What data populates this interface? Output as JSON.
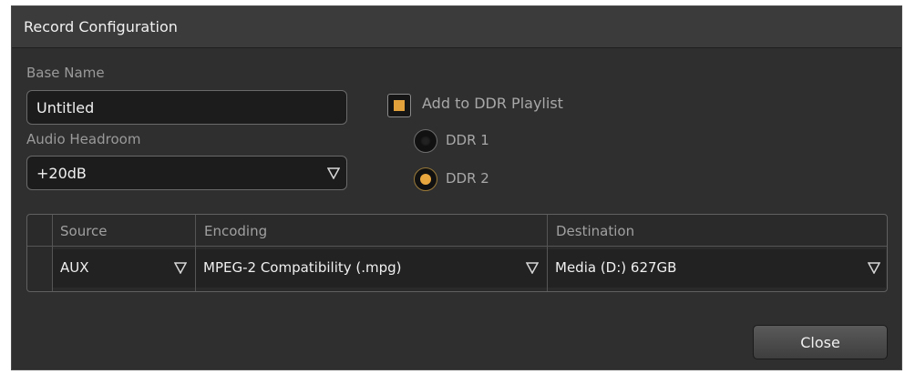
{
  "dialog": {
    "title": "Record Configuration"
  },
  "base_name": {
    "label": "Base Name",
    "value": "Untitled"
  },
  "audio_headroom": {
    "label": "Audio Headroom",
    "selected": "+20dB"
  },
  "ddr_playlist": {
    "checkbox_label": "Add to DDR Playlist",
    "checked": true,
    "options": [
      {
        "label": "DDR 1",
        "selected": false
      },
      {
        "label": "DDR 2",
        "selected": true
      }
    ]
  },
  "table": {
    "columns": [
      "Source",
      "Encoding",
      "Destination"
    ],
    "rows": [
      {
        "source": "AUX",
        "encoding": "MPEG-2 Compatibility (.mpg)",
        "destination": "Media (D:) 627GB"
      }
    ]
  },
  "buttons": {
    "close_label": "Close"
  },
  "colors": {
    "accent": "#e8a63e",
    "background": "#2f2f2f"
  }
}
